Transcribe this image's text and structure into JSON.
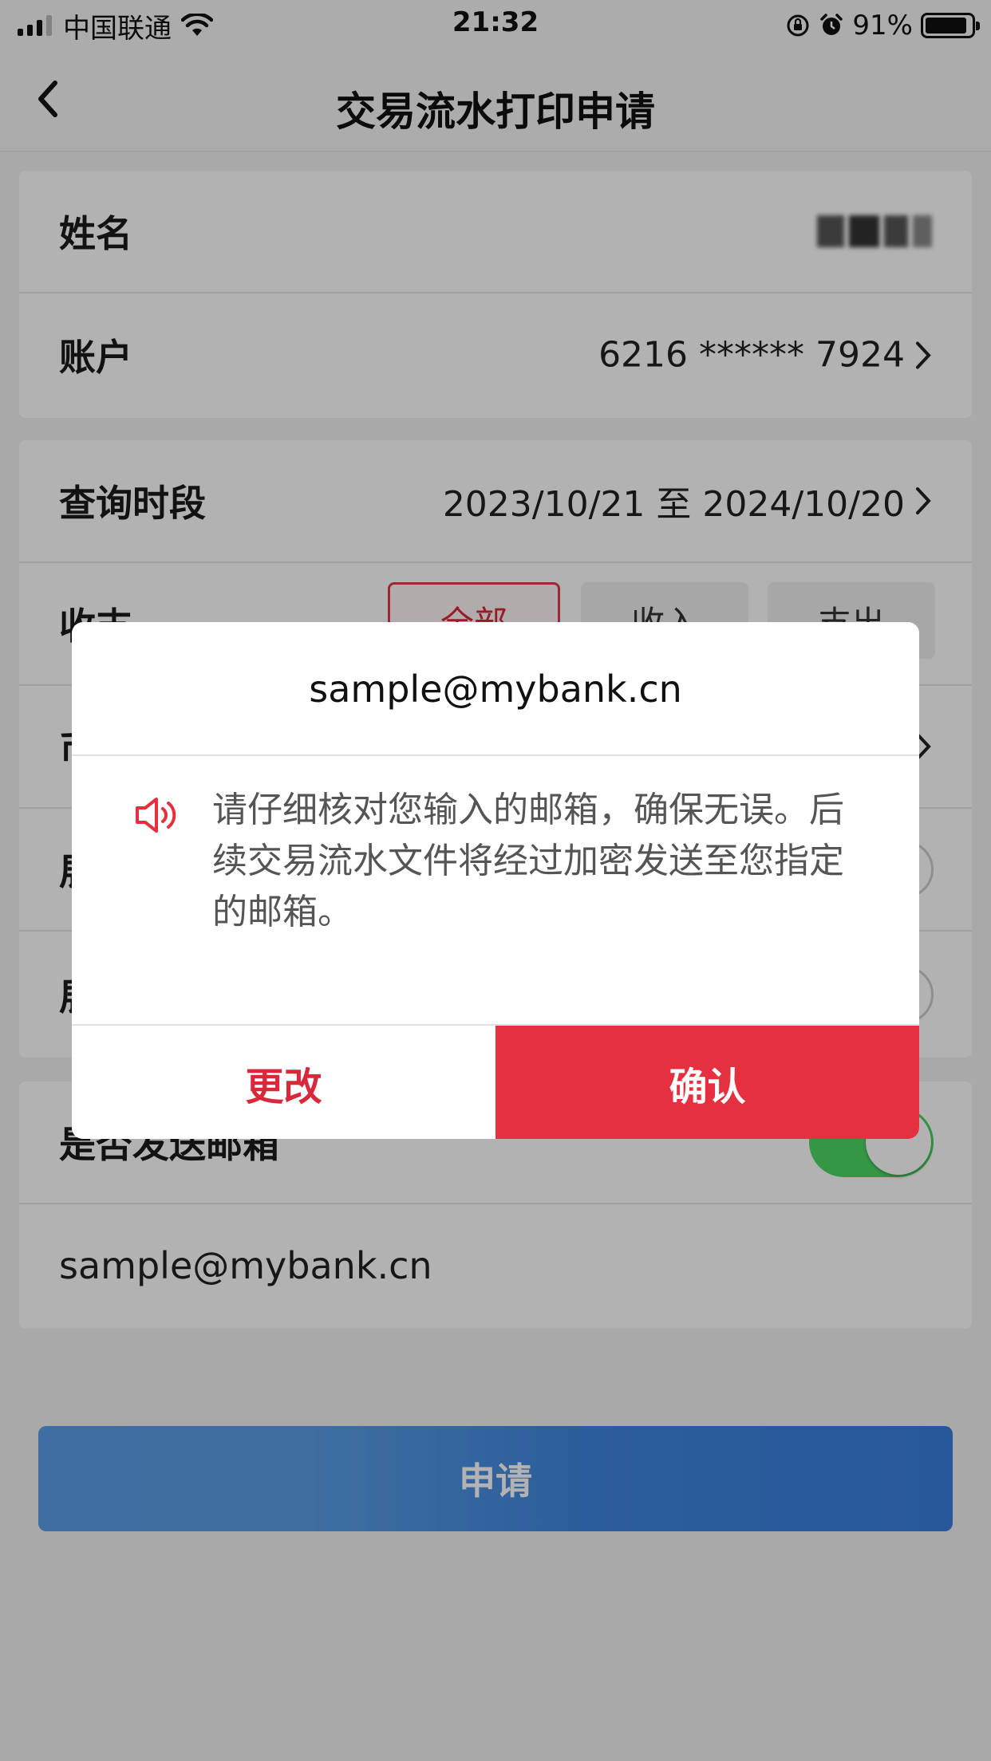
{
  "status_bar": {
    "carrier": "中国联通",
    "time": "21:32",
    "battery_percent": "91%",
    "battery_level": 0.91,
    "icons": [
      "signal-icon",
      "wifi-icon",
      "orientation-lock-icon",
      "alarm-icon",
      "battery-icon"
    ]
  },
  "nav": {
    "title": "交易流水打印申请",
    "back_icon": "chevron-left-icon"
  },
  "form": {
    "name_label": "姓名",
    "account_label": "账户",
    "account_value": "6216 ****** 7924",
    "period_label": "查询时段",
    "period_value": "2023/10/21 至 2024/10/20",
    "type_label": "收支",
    "type_options": [
      "全部",
      "收入",
      "支出"
    ],
    "type_selected": "全部",
    "row5_label": "币",
    "row6_label": "展",
    "row7_label": "展",
    "send_email_label": "是否发送邮箱",
    "send_email_on": true,
    "email_value": "sample@mybank.cn"
  },
  "apply_button": "申请",
  "dialog": {
    "email": "sample@mybank.cn",
    "message": "请仔细核对您输入的邮箱，确保无误。后续交易流水文件将经过加密发送至您指定的邮箱。",
    "icon": "speaker-icon",
    "change_label": "更改",
    "confirm_label": "确认"
  },
  "colors": {
    "accent_red": "#e5303f",
    "toggle_green": "#4cd964",
    "button_blue": "#4a90e2"
  }
}
